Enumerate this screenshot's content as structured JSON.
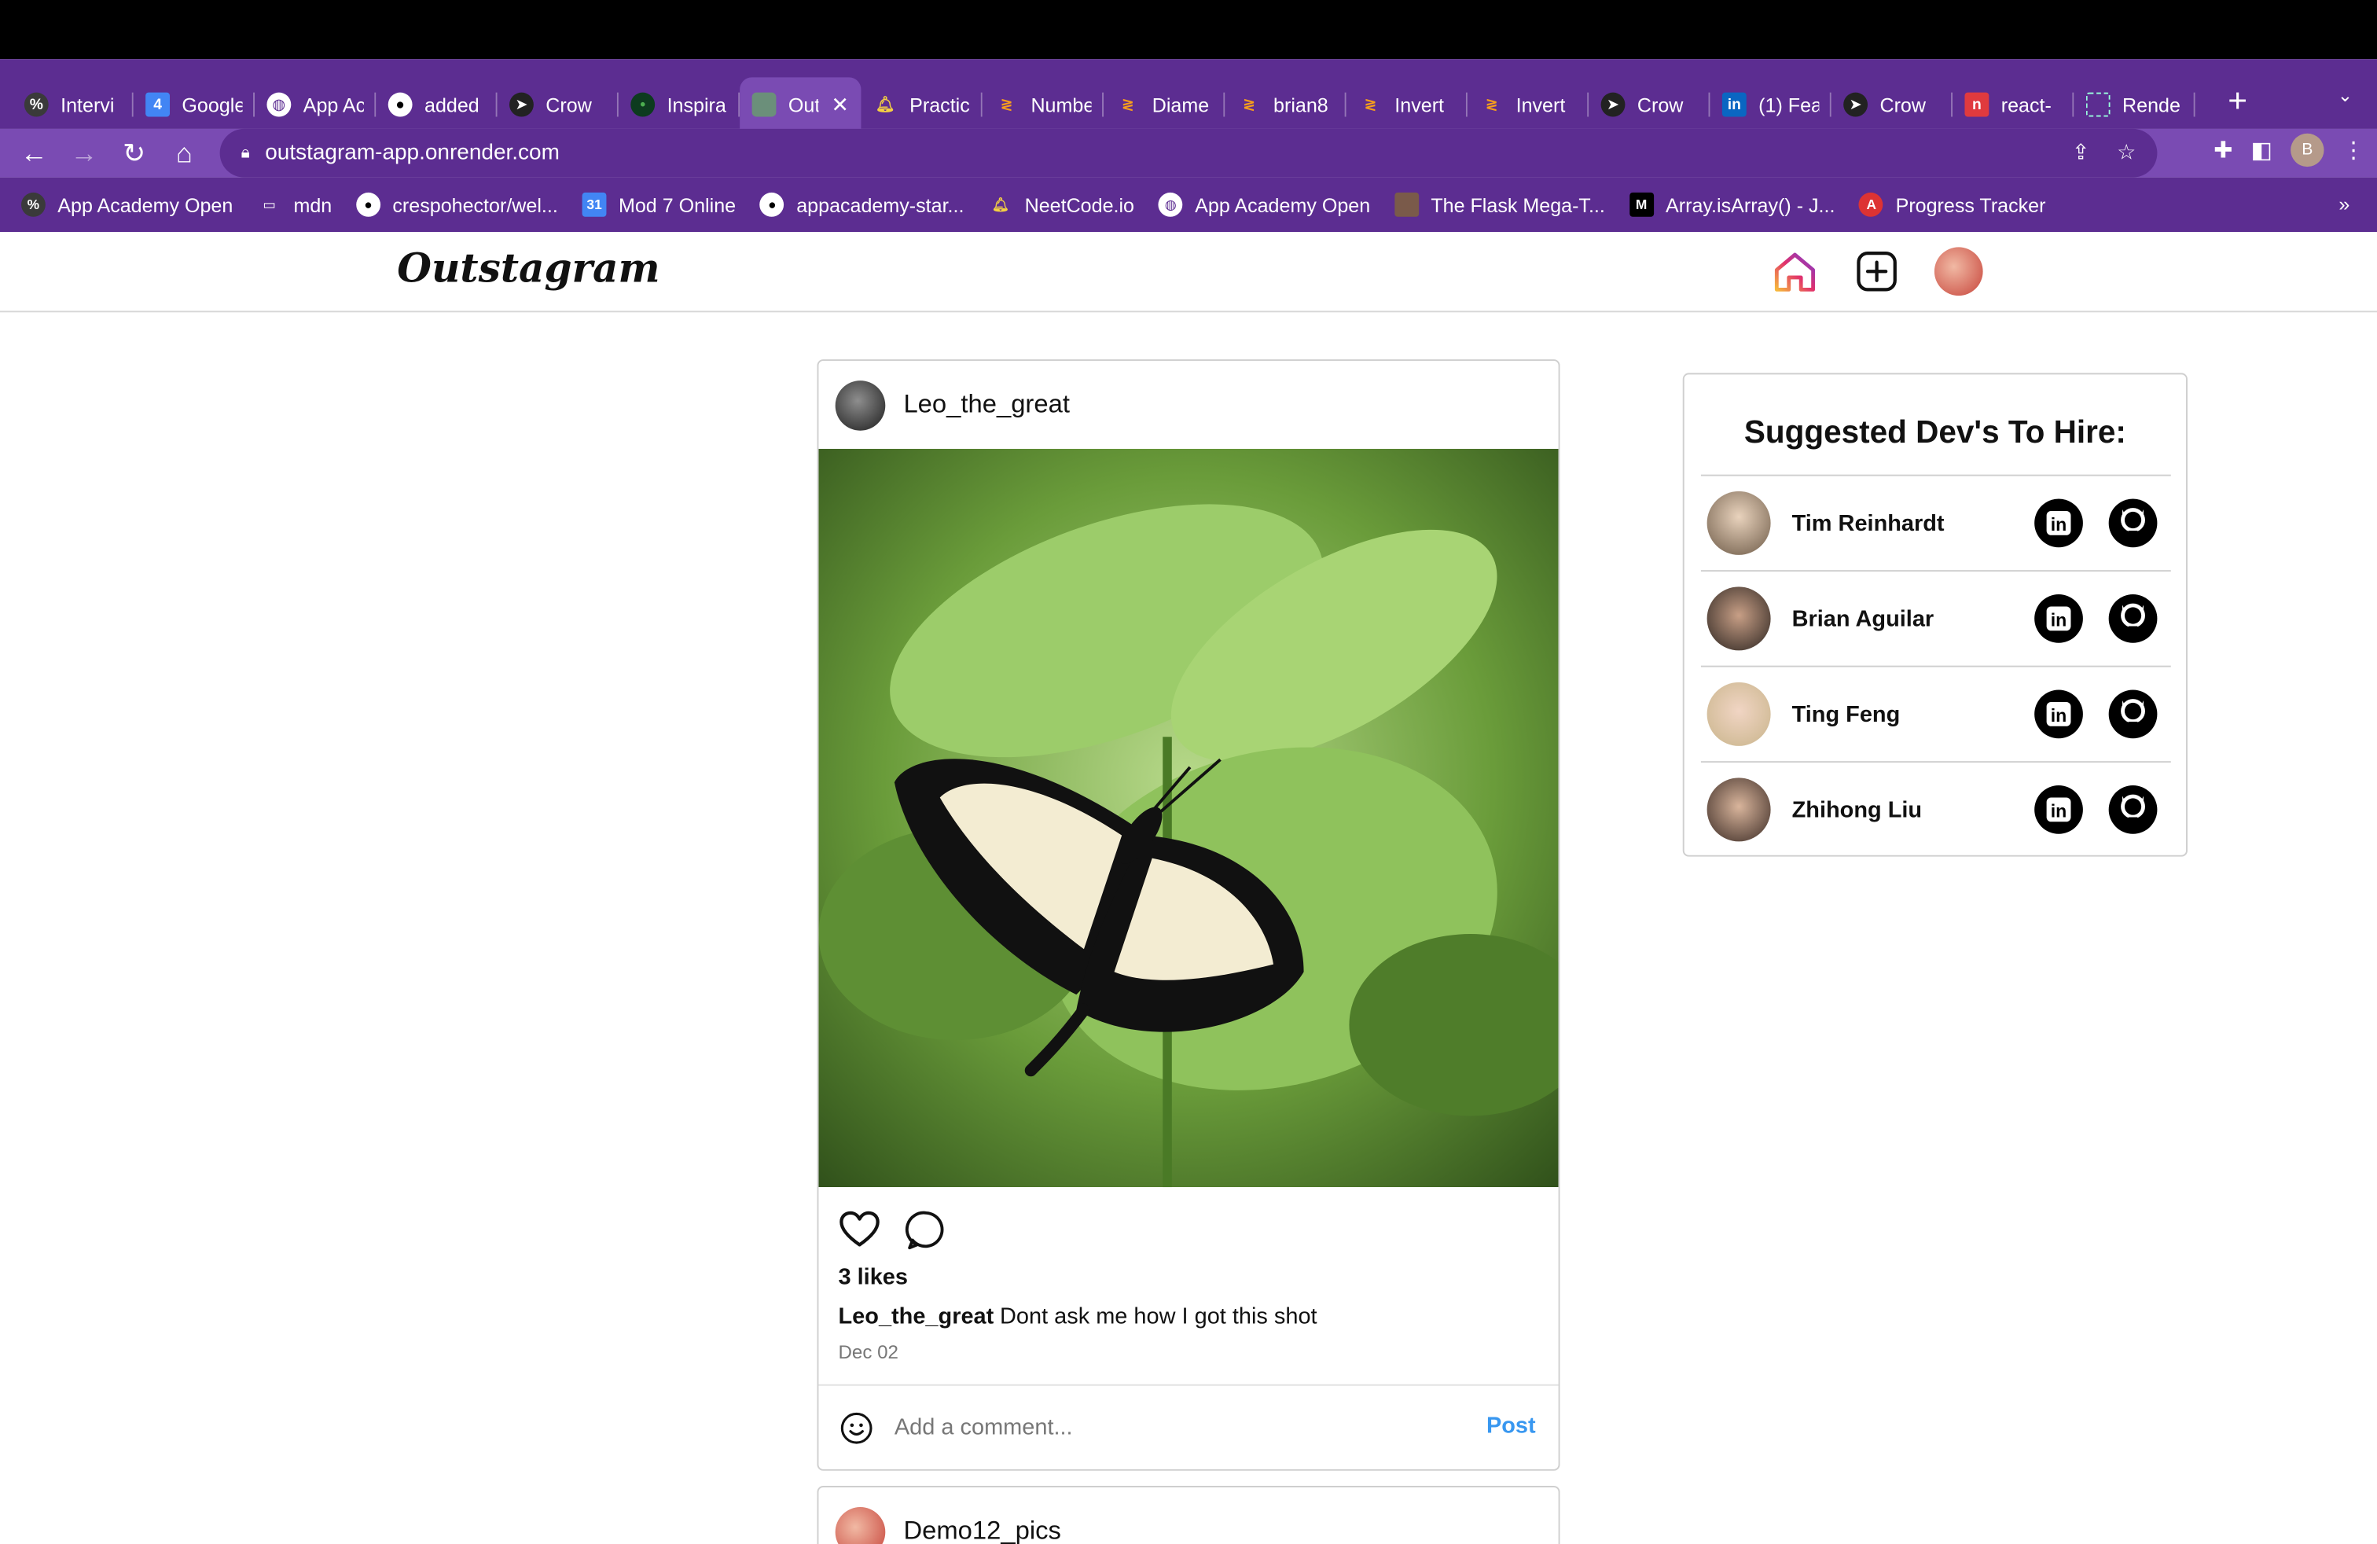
{
  "browser": {
    "tabs": [
      {
        "title": "Intervi",
        "icon": "circle-logo-icon"
      },
      {
        "title": "Google",
        "icon": "google-docs-icon"
      },
      {
        "title": "App Ac",
        "icon": "globe-icon"
      },
      {
        "title": "added",
        "icon": "github-icon"
      },
      {
        "title": "Crow",
        "icon": "crow-icon"
      },
      {
        "title": "Inspira",
        "icon": "dot-icon"
      },
      {
        "title": "Out",
        "icon": "page-icon",
        "active": true
      },
      {
        "title": "Practic",
        "icon": "bell-icon"
      },
      {
        "title": "Numbe",
        "icon": "leetcode-icon"
      },
      {
        "title": "Diame",
        "icon": "leetcode-icon"
      },
      {
        "title": "brian8",
        "icon": "leetcode-icon"
      },
      {
        "title": "Invert",
        "icon": "leetcode-icon"
      },
      {
        "title": "Invert",
        "icon": "leetcode-icon"
      },
      {
        "title": "Crow",
        "icon": "crow-icon"
      },
      {
        "title": "(1) Fea",
        "icon": "linkedin-icon"
      },
      {
        "title": "Crow",
        "icon": "crow-icon"
      },
      {
        "title": "react-",
        "icon": "react-icon"
      },
      {
        "title": "Rende",
        "icon": "render-icon"
      }
    ],
    "url": "outstagram-app.onrender.com",
    "profile_initial": "B",
    "bookmarks": [
      {
        "label": "App Academy Open",
        "icon": "circle-logo-icon"
      },
      {
        "label": "mdn",
        "icon": "folder-icon"
      },
      {
        "label": "crespohector/wel...",
        "icon": "github-icon"
      },
      {
        "label": "Mod 7 Online",
        "icon": "calendar-icon"
      },
      {
        "label": "appacademy-star...",
        "icon": "github-icon"
      },
      {
        "label": "NeetCode.io",
        "icon": "bell-icon"
      },
      {
        "label": "App Academy Open",
        "icon": "globe-icon"
      },
      {
        "label": "The Flask Mega-T...",
        "icon": "image-icon"
      },
      {
        "label": "Array.isArray() - J...",
        "icon": "mdn-icon"
      },
      {
        "label": "Progress Tracker",
        "icon": "a-icon"
      }
    ],
    "bookmarks_more": "»"
  },
  "app": {
    "logo": "Outstagram"
  },
  "post": {
    "username": "Leo_the_great",
    "likes": "3 likes",
    "caption_user": "Leo_the_great",
    "caption_text": "Dont ask me how I got this shot",
    "date": "Dec 02",
    "comment_placeholder": "Add a comment...",
    "post_button": "Post"
  },
  "next_post": {
    "username": "Demo12_pics"
  },
  "suggestions": {
    "title": "Suggested Dev's To Hire:",
    "devs": [
      {
        "name": "Tim Reinhardt"
      },
      {
        "name": "Brian Aguilar"
      },
      {
        "name": "Ting Feng"
      },
      {
        "name": "Zhihong Liu"
      }
    ]
  }
}
